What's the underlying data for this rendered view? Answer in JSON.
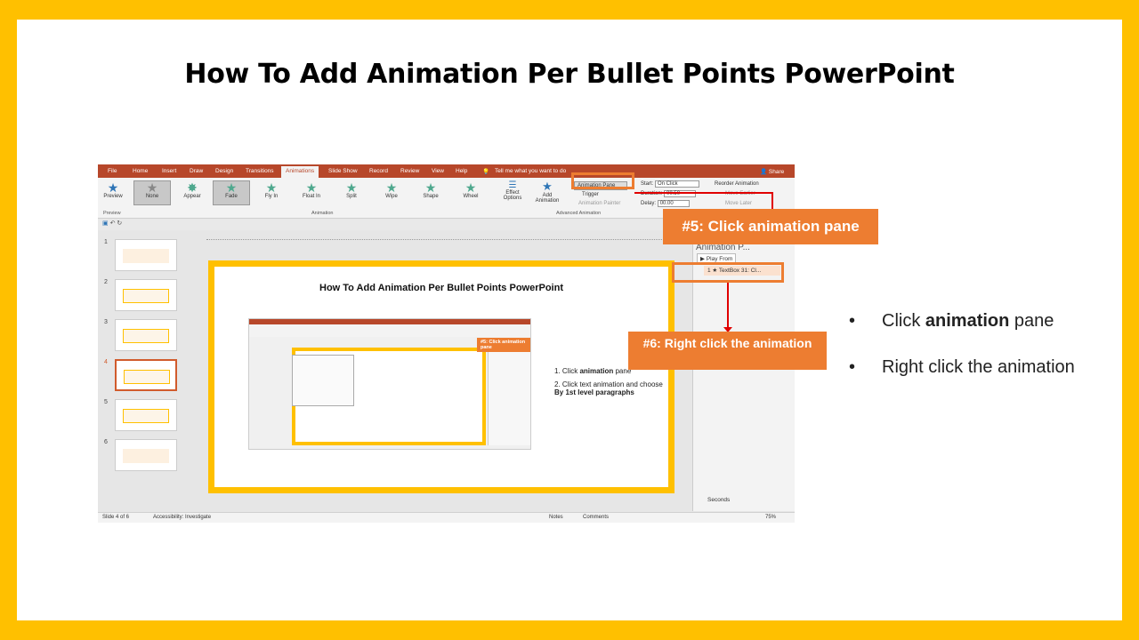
{
  "slide": {
    "title": "How To Add Animation Per Bullet Points PowerPoint",
    "bullets": [
      {
        "before": "Click ",
        "bold": "animation",
        "after": " pane"
      },
      {
        "before": "Right click the animation",
        "bold": "",
        "after": ""
      }
    ]
  },
  "screenshot": {
    "tabs": [
      "File",
      "Home",
      "Insert",
      "Draw",
      "Design",
      "Transitions",
      "Animations",
      "Slide Show",
      "Record",
      "Review",
      "View",
      "Help"
    ],
    "active_tab": "Animations",
    "tell_me": "Tell me what you want to do",
    "share": "Share",
    "preview_label": "Preview",
    "animations": [
      "None",
      "Appear",
      "Fade",
      "Fly In",
      "Float In",
      "Split",
      "Wipe",
      "Shape",
      "Wheel"
    ],
    "effect_options": "Effect Options",
    "add_animation": "Add Animation",
    "animation_pane_btn": "Animation Pane",
    "trigger": "Trigger",
    "animation_painter": "Animation Painter",
    "start_label": "Start:",
    "start_value": "On Click",
    "duration_label": "Duration:",
    "duration_value": "00.50",
    "delay_label": "Delay:",
    "delay_value": "00.00",
    "reorder": "Reorder Animation",
    "move_earlier": "Move Earlier",
    "move_later": "Move Later",
    "group_preview": "Preview",
    "group_animation": "Animation",
    "group_advanced": "Advanced Animation",
    "thumb_numbers": [
      "1",
      "2",
      "3",
      "4",
      "5",
      "6"
    ],
    "inner_title": "How To Add Animation Per Bullet Points PowerPoint",
    "inner_list": [
      {
        "n": "1.",
        "before": "Click ",
        "bold": "animation",
        "after": " pane"
      },
      {
        "n": "2.",
        "before": "Click text animation and choose ",
        "bold": "By 1st level paragraphs",
        "after": ""
      }
    ],
    "pane_title": "Animation P...",
    "play_from": "Play From",
    "pane_item": "1 ★ TextBox 31: Cl...",
    "seconds": "Seconds",
    "status_slide": "Slide 4 of 6",
    "accessibility": "Accessibility: Investigate",
    "notes": "Notes",
    "comments": "Comments",
    "zoom": "75%"
  },
  "callouts": {
    "step5": "#5: Click animation pane",
    "step6": "#6: Right click the animation"
  }
}
